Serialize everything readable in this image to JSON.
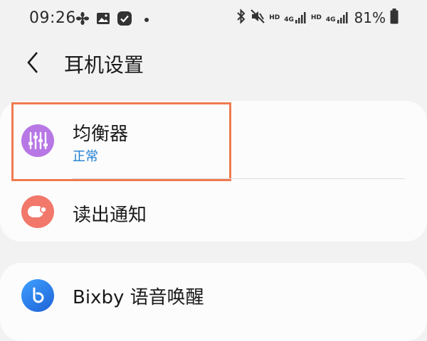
{
  "status_bar": {
    "time": "09:26",
    "net_labels": [
      "HD",
      "4G",
      "HD",
      "4G"
    ],
    "battery": "81%"
  },
  "header": {
    "title": "耳机设置"
  },
  "settings": {
    "items": [
      {
        "title": "均衡器",
        "subtitle": "正常",
        "icon": "equalizer-sliders-icon",
        "color": "#b777e4"
      },
      {
        "title": "读出通知",
        "icon": "read-notifications-icon",
        "color": "#f2786b"
      },
      {
        "title": "Bixby 语音唤醒",
        "icon": "bixby-icon",
        "color": "#2b7ff0"
      }
    ]
  },
  "accent_colors": {
    "highlight_box": "#f07a50",
    "subtitle_blue": "#1d7fd4"
  }
}
